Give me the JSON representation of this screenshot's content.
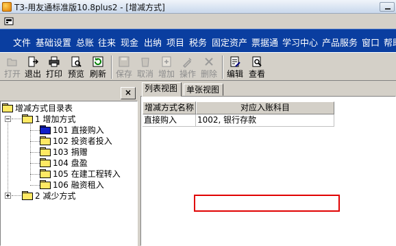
{
  "window": {
    "title": "T3-用友通标准版10.8plus2 - [增减方式]"
  },
  "menu": [
    "文件",
    "基础设置",
    "总账",
    "往来",
    "现金",
    "出纳",
    "项目",
    "税务",
    "固定资产",
    "票据通",
    "学习中心",
    "产品服务",
    "窗口",
    "帮助"
  ],
  "toolbar": {
    "open": "打开",
    "exit": "退出",
    "print": "打印",
    "preview": "预览",
    "refresh": "刷新",
    "save": "保存",
    "cancel": "取消",
    "add": "增加",
    "operate": "操作",
    "delete": "删除",
    "edit": "编辑",
    "view": "查看"
  },
  "left": {
    "close_label": "×"
  },
  "tree": {
    "root": "增减方式目录表",
    "add_group": "1  增加方式",
    "children": [
      "101  直接购入",
      "102  投资者投入",
      "103  捐赠",
      "104  盘盈",
      "105  在建工程转入",
      "106  融资租入"
    ],
    "reduce_group": "2  减少方式"
  },
  "tabs": {
    "list": "列表视图",
    "single": "单张视图"
  },
  "table": {
    "headers": [
      "增减方式名称",
      "对应入账科目"
    ],
    "rows": [
      {
        "name": "直接购入",
        "account": "1002, 银行存款"
      }
    ]
  },
  "colors": {
    "menubar": "#0a3ea0",
    "highlight_box": "#e00000"
  }
}
